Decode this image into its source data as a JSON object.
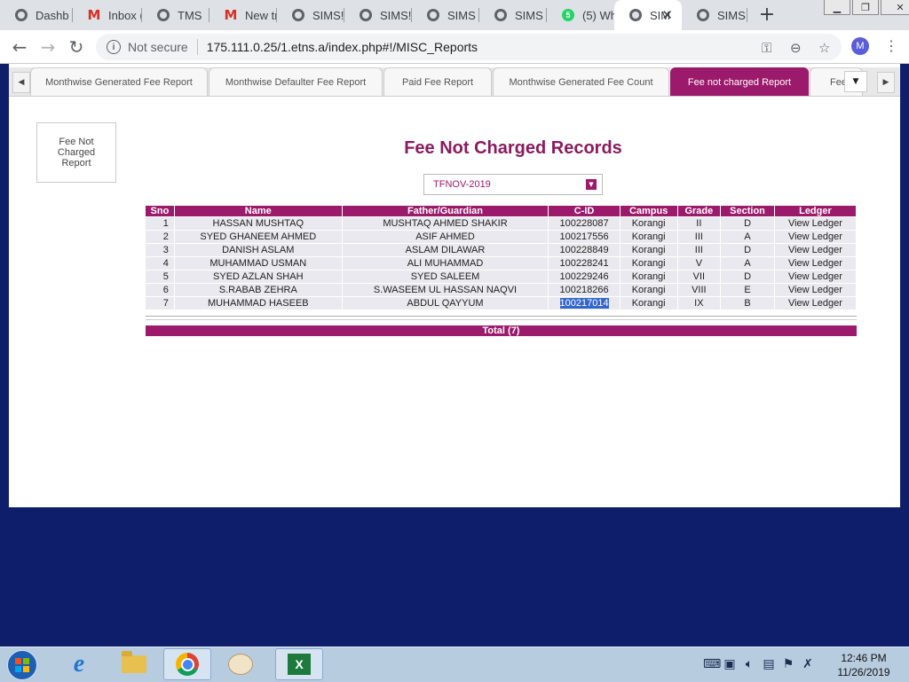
{
  "browser": {
    "tabs": [
      {
        "title": "Dashb",
        "icon": "globe-icon",
        "active": false
      },
      {
        "title": "Inbox (",
        "icon": "gmail-icon",
        "active": false
      },
      {
        "title": "TMS",
        "icon": "globe-icon",
        "active": false
      },
      {
        "title": "New tr",
        "icon": "gmail-icon",
        "active": false
      },
      {
        "title": "SIMS!N",
        "icon": "globe-icon",
        "active": false
      },
      {
        "title": "SIMS!N",
        "icon": "globe-icon",
        "active": false
      },
      {
        "title": "SIMS -",
        "icon": "globe-icon",
        "active": false
      },
      {
        "title": "SIMS -",
        "icon": "globe-icon",
        "active": false
      },
      {
        "title": "(5) Wh",
        "icon": "whatsapp-icon",
        "active": false
      },
      {
        "title": "SIM",
        "icon": "globe-icon",
        "active": true
      },
      {
        "title": "SIMS!N",
        "icon": "globe-icon",
        "active": false
      }
    ],
    "whatsapp_count": "5",
    "security_label": "Not secure",
    "url": "175.111.0.25/1.etns.a/index.php#!/MISC_Reports",
    "profile_initial": "M"
  },
  "report_tabs": [
    {
      "label": "Monthwise Generated Fee Report",
      "active": false
    },
    {
      "label": "Monthwise Defaulter Fee Report",
      "active": false
    },
    {
      "label": "Paid Fee Report",
      "active": false
    },
    {
      "label": "Monthwise Generated Fee Count",
      "active": false
    },
    {
      "label": "Fee not charged Report",
      "active": true
    },
    {
      "label": "Fee",
      "active": false
    }
  ],
  "sidebar_box": "Fee Not Charged Report",
  "page_title": "Fee Not Charged Records",
  "period_select": {
    "value": "TFNOV-2019"
  },
  "table": {
    "headers": [
      "Sno",
      "Name",
      "Father/Guardian",
      "C-ID",
      "Campus",
      "Grade",
      "Section",
      "Ledger"
    ],
    "rows": [
      {
        "sno": "1",
        "name": "HASSAN MUSHTAQ",
        "father": "MUSHTAQ AHMED SHAKIR",
        "cid": "100228087",
        "campus": "Korangi",
        "grade": "II",
        "section": "D",
        "ledger": "View Ledger"
      },
      {
        "sno": "2",
        "name": "SYED GHANEEM AHMED",
        "father": "ASIF AHMED",
        "cid": "100217556",
        "campus": "Korangi",
        "grade": "III",
        "section": "A",
        "ledger": "View Ledger"
      },
      {
        "sno": "3",
        "name": "DANISH ASLAM",
        "father": "ASLAM DILAWAR",
        "cid": "100228849",
        "campus": "Korangi",
        "grade": "III",
        "section": "D",
        "ledger": "View Ledger"
      },
      {
        "sno": "4",
        "name": "MUHAMMAD USMAN",
        "father": "ALI MUHAMMAD",
        "cid": "100228241",
        "campus": "Korangi",
        "grade": "V",
        "section": "A",
        "ledger": "View Ledger"
      },
      {
        "sno": "5",
        "name": "SYED AZLAN SHAH",
        "father": "SYED SALEEM",
        "cid": "100229246",
        "campus": "Korangi",
        "grade": "VII",
        "section": "D",
        "ledger": "View Ledger"
      },
      {
        "sno": "6",
        "name": "S.RABAB ZEHRA",
        "father": "S.WASEEM UL HASSAN NAQVI",
        "cid": "100218266",
        "campus": "Korangi",
        "grade": "VIII",
        "section": "E",
        "ledger": "View Ledger"
      },
      {
        "sno": "7",
        "name": "MUHAMMAD HASEEB",
        "father": "ABDUL QAYYUM",
        "cid": "100217014",
        "campus": "Korangi",
        "grade": "IX",
        "section": "B",
        "ledger": "View Ledger",
        "cid_selected": true
      }
    ]
  },
  "total_label": "Total (7)",
  "taskbar": {
    "apps": [
      "internet-explorer",
      "file-explorer",
      "google-chrome",
      "paint",
      "excel"
    ],
    "time": "12:46 PM",
    "date": "11/26/2019"
  },
  "colors": {
    "accent": "#9b1a6b",
    "title": "#8b1a5e",
    "desktop": "#0f1e6a"
  }
}
